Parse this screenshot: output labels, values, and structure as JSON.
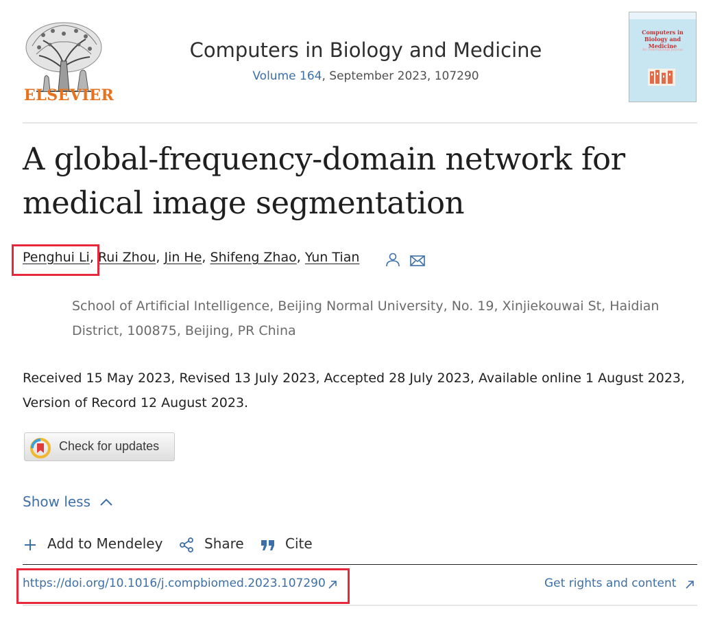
{
  "header": {
    "publisher_logo_text": "ELSEVIER",
    "journal_title": "Computers in Biology and Medicine",
    "volume_link": "Volume 164",
    "issue_info": ", September 2023, 107290",
    "cover_title": "Computers in Biology and Medicine",
    "cover_tagline": "An International Journal"
  },
  "article": {
    "title": "A global-frequency-domain network for medical image segmentation",
    "authors": [
      "Penghui Li",
      "Rui Zhou",
      "Jin He",
      "Shifeng Zhao",
      "Yun Tian"
    ],
    "author_separator": ",",
    "affiliation": "School of Artificial Intelligence, Beijing Normal University, No. 19, Xinjiekouwai St, Haidian District, 100875, Beijing, PR China",
    "dates": "Received 15 May 2023, Revised 13 July 2023, Accepted 28 July 2023, Available online 1 August 2023, Version of Record 12 August 2023."
  },
  "actions": {
    "check_updates_label": "Check for updates",
    "show_less_label": "Show less",
    "add_mendeley_label": "Add to Mendeley",
    "share_label": "Share",
    "cite_label": "Cite"
  },
  "links": {
    "doi": "https://doi.org/10.1016/j.compbiomed.2023.107290",
    "rights": "Get rights and content"
  },
  "colors": {
    "link_blue": "#3d6fa8",
    "elsevier_orange": "#e9711c",
    "highlight_red": "#e8273a"
  },
  "icons": {
    "author_profile": "person-icon",
    "author_email": "envelope-icon",
    "show_less": "chevron-up-icon",
    "mendeley": "plus-icon",
    "share": "share-icon",
    "cite": "quote-icon",
    "external": "external-link-arrow-icon"
  }
}
